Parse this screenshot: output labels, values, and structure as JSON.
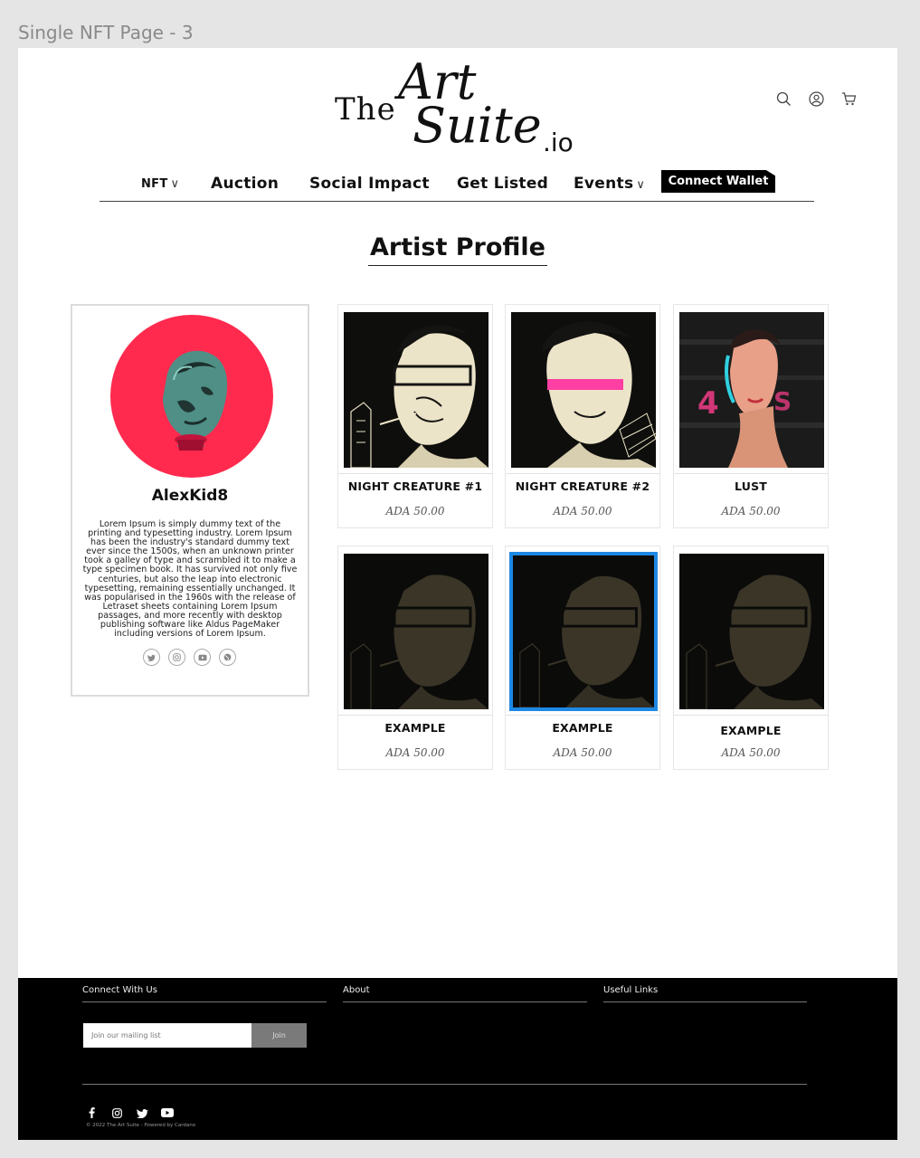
{
  "frame_label": "Single NFT Page - 3",
  "header": {
    "logo": {
      "the": "The",
      "art": "Art",
      "suite": "Suite",
      "io": ".io"
    },
    "icons": [
      "search-icon",
      "user-icon",
      "cart-icon"
    ]
  },
  "nav": {
    "items": [
      {
        "label": "NFT",
        "has_dropdown": true
      },
      {
        "label": "Auction",
        "has_dropdown": false
      },
      {
        "label": "Social Impact",
        "has_dropdown": false
      },
      {
        "label": "Get Listed",
        "has_dropdown": false
      },
      {
        "label": "Events",
        "has_dropdown": true
      }
    ],
    "dropdown_glyph": "∨",
    "connect_wallet": "Connect Wallet"
  },
  "section_title": "Artist Profile",
  "profile": {
    "name": "AlexKid8",
    "avatar_bg": "#ff2a4e",
    "bio": "Lorem Ipsum is simply dummy text of the printing and typesetting industry. Lorem Ipsum has been the industry's standard dummy text ever since the 1500s, when an unknown printer took a galley of type and scrambled it to make a type specimen book. It has survived not only five centuries, but also the leap into electronic typesetting, remaining essentially unchanged. It was popularised in the 1960s with the release of Letraset sheets containing Lorem Ipsum passages, and more recently with desktop publishing software like Aldus PageMaker including versions of Lorem Ipsum.",
    "socials": [
      "twitter-icon",
      "instagram-icon",
      "youtube-icon",
      "globe-icon"
    ]
  },
  "nfts": [
    {
      "title": "NIGHT CREATURE #1",
      "price": "ADA 50.00"
    },
    {
      "title": "NIGHT CREATURE #2",
      "price": "ADA 50.00"
    },
    {
      "title": "LUST",
      "price": "ADA 50.00"
    },
    {
      "title": "EXAMPLE",
      "price": "ADA 50.00"
    },
    {
      "title": "EXAMPLE",
      "price": "ADA 50.00",
      "selected": true
    },
    {
      "title": "EXAMPLE",
      "price": "ADA 50.00"
    }
  ],
  "footer": {
    "columns": [
      "Connect With Us",
      "About",
      "Useful Links"
    ],
    "mailing_placeholder": "Join our mailing list",
    "join_label": "Join",
    "socials": [
      "facebook-icon",
      "instagram-icon",
      "twitter-icon",
      "youtube-icon"
    ],
    "copyright": "© 2022 The Art Suite - Powered by Cardano"
  },
  "colors": {
    "accent_selected": "#1e88e5",
    "footer_bg": "#000000"
  }
}
